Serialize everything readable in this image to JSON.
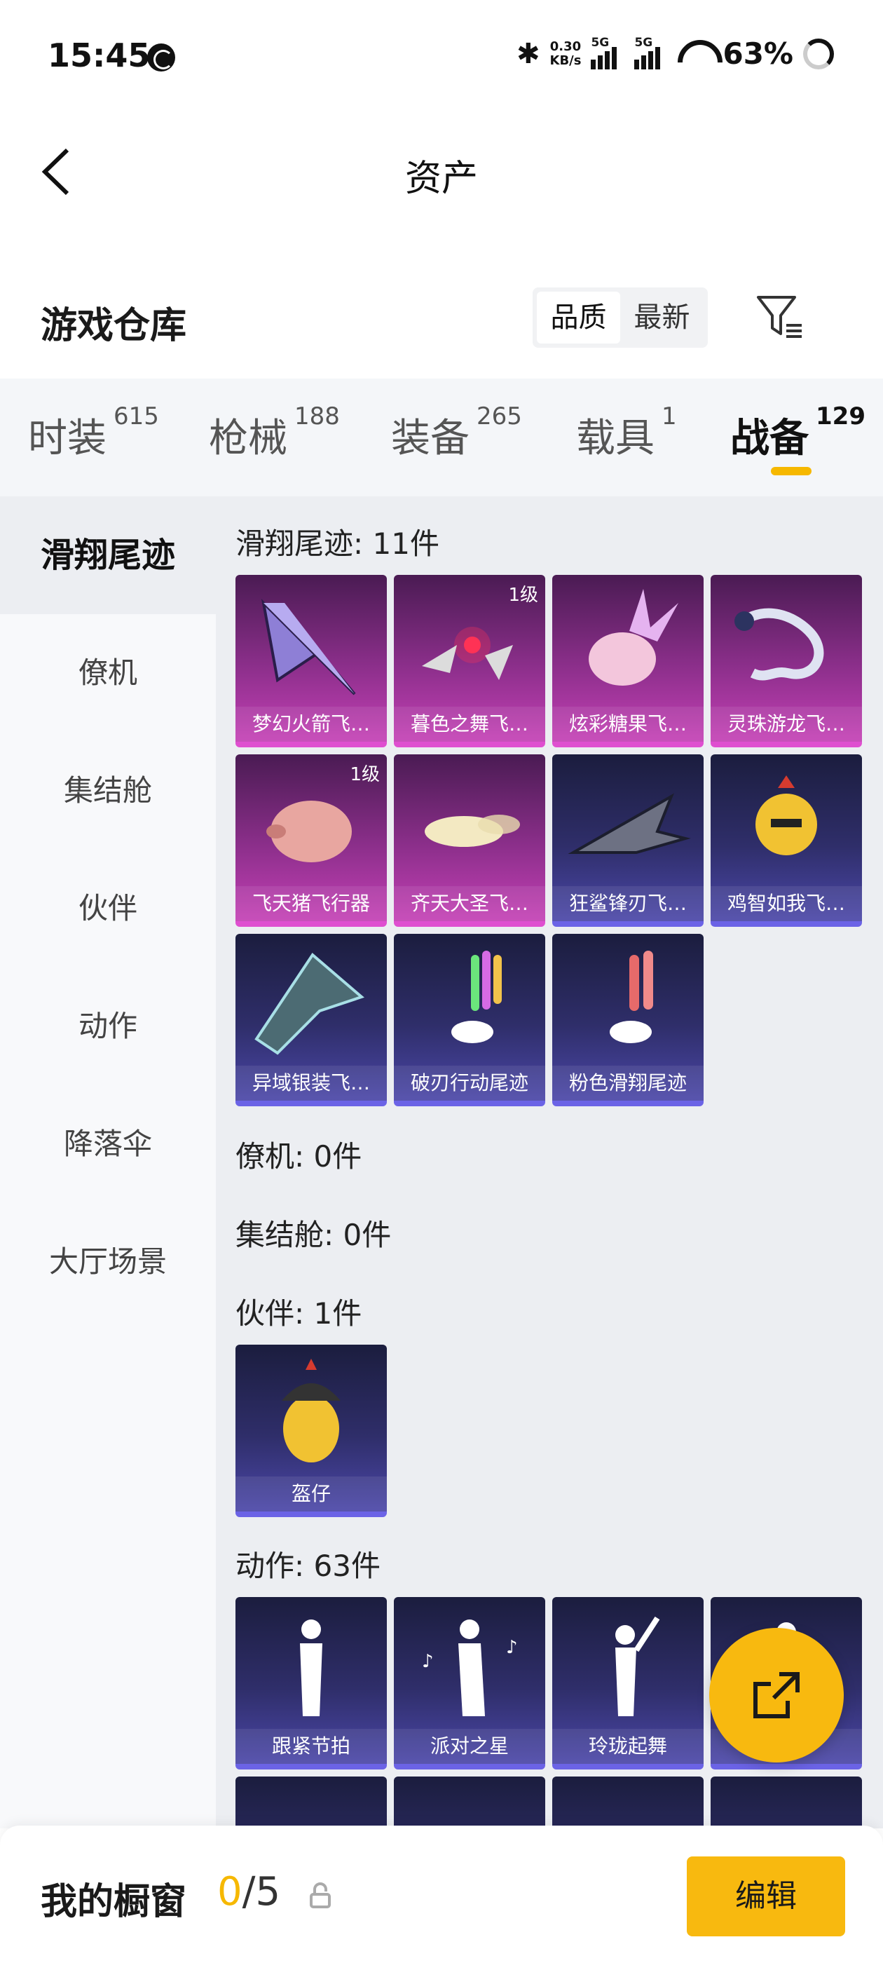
{
  "status_bar": {
    "time": "15:45",
    "speed_value": "0.30",
    "speed_unit": "KB/s",
    "sim1": "5G",
    "sim2": "5G",
    "battery": "63%"
  },
  "nav": {
    "title": "资产"
  },
  "section": {
    "title": "游戏仓库",
    "sort_options": [
      "品质",
      "最新"
    ],
    "sort_active": "品质"
  },
  "tabs": [
    {
      "label": "时装",
      "count": "615"
    },
    {
      "label": "枪械",
      "count": "188"
    },
    {
      "label": "装备",
      "count": "265"
    },
    {
      "label": "载具",
      "count": "1"
    },
    {
      "label": "战备",
      "count": "129"
    }
  ],
  "active_tab": "战备",
  "sidebar": {
    "items": [
      "滑翔尾迹",
      "僚机",
      "集结舱",
      "伙伴",
      "动作",
      "降落伞",
      "大厅场景"
    ],
    "active": "滑翔尾迹"
  },
  "groups": {
    "glide": {
      "title": "滑翔尾迹: 11件",
      "items": [
        {
          "name": "梦幻火箭飞…",
          "level": "",
          "rarity": "pink"
        },
        {
          "name": "暮色之舞飞…",
          "level": "1级",
          "rarity": "pink"
        },
        {
          "name": "炫彩糖果飞…",
          "level": "",
          "rarity": "pink"
        },
        {
          "name": "灵珠游龙飞…",
          "level": "",
          "rarity": "pink"
        },
        {
          "name": "飞天猪飞行器",
          "level": "1级",
          "rarity": "pink"
        },
        {
          "name": "齐天大圣飞…",
          "level": "",
          "rarity": "pink"
        },
        {
          "name": "狂鲨锋刃飞…",
          "level": "",
          "rarity": "blue"
        },
        {
          "name": "鸡智如我飞…",
          "level": "",
          "rarity": "blue"
        },
        {
          "name": "异域银装飞…",
          "level": "",
          "rarity": "blue"
        },
        {
          "name": "破刃行动尾迹",
          "level": "",
          "rarity": "blue"
        },
        {
          "name": "粉色滑翔尾迹",
          "level": "",
          "rarity": "blue"
        }
      ]
    },
    "wingman": {
      "title": "僚机: 0件"
    },
    "capsule": {
      "title": "集结舱: 0件"
    },
    "partner": {
      "title": "伙伴: 1件",
      "items": [
        {
          "name": "盔仔",
          "level": "",
          "rarity": "blue"
        }
      ]
    },
    "emote": {
      "title": "动作: 63件",
      "items": [
        {
          "name": "跟紧节拍",
          "level": "",
          "rarity": "blue"
        },
        {
          "name": "派对之星",
          "level": "",
          "rarity": "blue"
        },
        {
          "name": "玲珑起舞",
          "level": "",
          "rarity": "blue"
        },
        {
          "name": "…力",
          "level": "",
          "rarity": "blue"
        }
      ]
    }
  },
  "bottom": {
    "title": "我的橱窗",
    "current": "0",
    "separator": "/",
    "max": "5",
    "edit_label": "编辑"
  },
  "colors": {
    "accent": "#f8b90f",
    "pink_rarity": "#c440b5",
    "blue_rarity": "#4b47a8"
  }
}
